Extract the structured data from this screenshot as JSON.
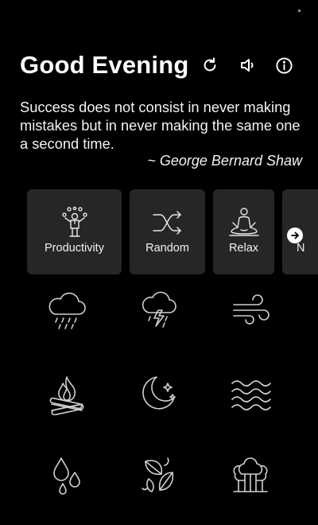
{
  "header": {
    "greeting": "Good Evening",
    "icons": [
      "refresh-icon",
      "volume-icon",
      "info-icon"
    ]
  },
  "quote": {
    "text": "Success does not consist in never making mistakes but in never making the same one a second time.",
    "author": "~ George Bernard Shaw"
  },
  "categories": [
    {
      "label": "Productivity",
      "icon": "juggler-icon"
    },
    {
      "label": "Random",
      "icon": "shuffle-icon"
    },
    {
      "label": "Relax",
      "icon": "meditation-icon"
    },
    {
      "label": "N",
      "icon": "arrow-right-icon"
    }
  ],
  "sounds": [
    "rain-cloud-icon",
    "thunderstorm-icon",
    "wind-icon",
    "campfire-icon",
    "night-moon-icon",
    "waves-icon",
    "water-drops-icon",
    "leaves-icon",
    "forest-icon"
  ],
  "colors": {
    "background": "#000000",
    "card": "#262626",
    "text": "#ffffff",
    "icon_stroke": "#cfcfcf"
  }
}
